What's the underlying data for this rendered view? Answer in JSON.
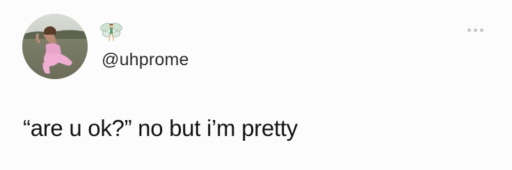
{
  "tweet": {
    "avatar_icon": "profile-photo",
    "name_emoji_icon": "fairy-emoji",
    "handle": "@uhprome",
    "more_icon": "ellipsis-icon",
    "text": "“are u ok?” no but i’m pretty"
  }
}
